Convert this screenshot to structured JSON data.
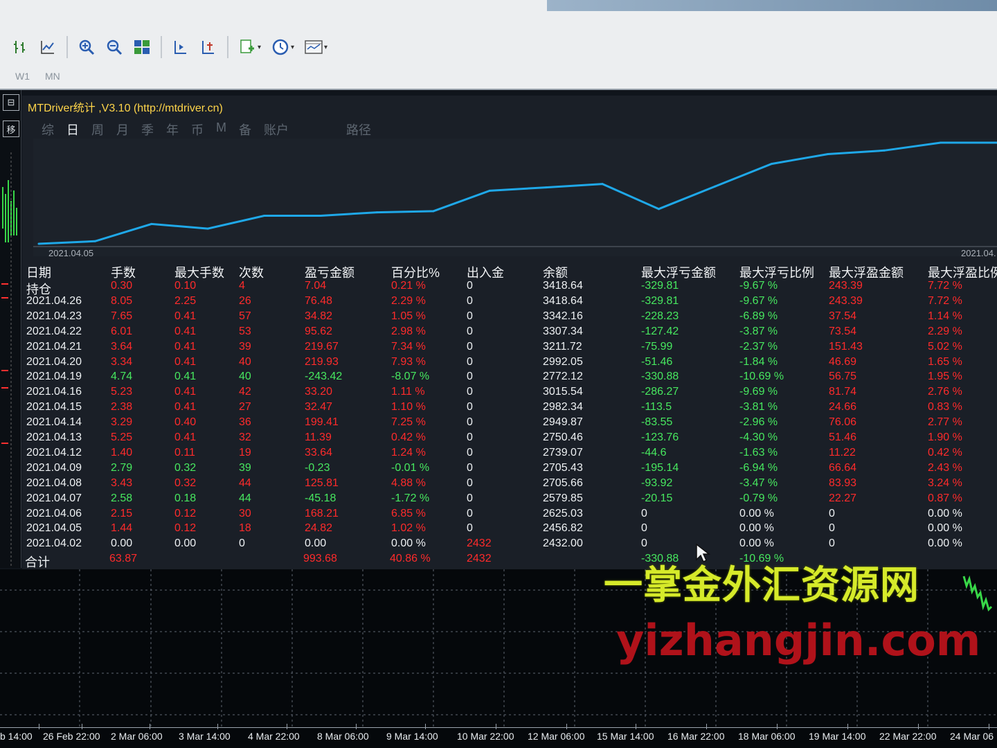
{
  "toolbar": {
    "timeframes": [
      "W1",
      "MN"
    ],
    "icons": [
      "bar-chart-icon",
      "line-chart-icon",
      "zoom-in-icon",
      "zoom-out-icon",
      "tile-windows-icon",
      "scroll-chart-icon",
      "chart-shift-icon",
      "add-indicator-icon",
      "clock-icon",
      "template-icon"
    ]
  },
  "panel": {
    "title": "MTDriver统计 ,V3.10 (http://mtdriver.cn)",
    "tabs": [
      "综",
      "日",
      "周",
      "月",
      "季",
      "年",
      "币",
      "M",
      "备",
      "账户"
    ],
    "active_tab": "日",
    "path_label": "路径"
  },
  "chart_data": {
    "type": "line",
    "x": [
      "2021.04.02",
      "2021.04.05",
      "2021.04.06",
      "2021.04.07",
      "2021.04.08",
      "2021.04.09",
      "2021.04.12",
      "2021.04.13",
      "2021.04.14",
      "2021.04.15",
      "2021.04.16",
      "2021.04.19",
      "2021.04.20",
      "2021.04.21",
      "2021.04.22",
      "2021.04.23",
      "2021.04.26",
      "持仓"
    ],
    "values": [
      2432.0,
      2456.82,
      2625.03,
      2579.85,
      2705.66,
      2705.43,
      2739.07,
      2750.46,
      2949.87,
      2982.34,
      3015.54,
      2772.12,
      2992.05,
      3211.72,
      3307.34,
      3342.16,
      3418.64,
      3418.64
    ],
    "x_start_label": "2021.04.05",
    "x_end_label": "2021.04.",
    "color": "#1fa8e8"
  },
  "table": {
    "headers": [
      "日期",
      "手数",
      "最大手数",
      "次数",
      "盈亏金额",
      "百分比%",
      "出入金",
      "余额",
      "最大浮亏金额",
      "最大浮亏比例",
      "最大浮盈金额",
      "最大浮盈比例"
    ],
    "rows": [
      [
        "持仓",
        "0.30",
        "0.10",
        "4",
        "7.04",
        "0.21 %",
        "0",
        "3418.64",
        "-329.81",
        "-9.67 %",
        "243.39",
        "7.72 %"
      ],
      [
        "2021.04.26",
        "8.05",
        "2.25",
        "26",
        "76.48",
        "2.29 %",
        "0",
        "3418.64",
        "-329.81",
        "-9.67 %",
        "243.39",
        "7.72 %"
      ],
      [
        "2021.04.23",
        "7.65",
        "0.41",
        "57",
        "34.82",
        "1.05 %",
        "0",
        "3342.16",
        "-228.23",
        "-6.89 %",
        "37.54",
        "1.14 %"
      ],
      [
        "2021.04.22",
        "6.01",
        "0.41",
        "53",
        "95.62",
        "2.98 %",
        "0",
        "3307.34",
        "-127.42",
        "-3.87 %",
        "73.54",
        "2.29 %"
      ],
      [
        "2021.04.21",
        "3.64",
        "0.41",
        "39",
        "219.67",
        "7.34 %",
        "0",
        "3211.72",
        "-75.99",
        "-2.37 %",
        "151.43",
        "5.02 %"
      ],
      [
        "2021.04.20",
        "3.34",
        "0.41",
        "40",
        "219.93",
        "7.93 %",
        "0",
        "2992.05",
        "-51.46",
        "-1.84 %",
        "46.69",
        "1.65 %"
      ],
      [
        "2021.04.19",
        "4.74",
        "0.41",
        "40",
        "-243.42",
        "-8.07 %",
        "0",
        "2772.12",
        "-330.88",
        "-10.69 %",
        "56.75",
        "1.95 %"
      ],
      [
        "2021.04.16",
        "5.23",
        "0.41",
        "42",
        "33.20",
        "1.11 %",
        "0",
        "3015.54",
        "-286.27",
        "-9.69 %",
        "81.74",
        "2.76 %"
      ],
      [
        "2021.04.15",
        "2.38",
        "0.41",
        "27",
        "32.47",
        "1.10 %",
        "0",
        "2982.34",
        "-113.5",
        "-3.81 %",
        "24.66",
        "0.83 %"
      ],
      [
        "2021.04.14",
        "3.29",
        "0.40",
        "36",
        "199.41",
        "7.25 %",
        "0",
        "2949.87",
        "-83.55",
        "-2.96 %",
        "76.06",
        "2.77 %"
      ],
      [
        "2021.04.13",
        "5.25",
        "0.41",
        "32",
        "11.39",
        "0.42 %",
        "0",
        "2750.46",
        "-123.76",
        "-4.30 %",
        "51.46",
        "1.90 %"
      ],
      [
        "2021.04.12",
        "1.40",
        "0.11",
        "19",
        "33.64",
        "1.24 %",
        "0",
        "2739.07",
        "-44.6",
        "-1.63 %",
        "11.22",
        "0.42 %"
      ],
      [
        "2021.04.09",
        "2.79",
        "0.32",
        "39",
        "-0.23",
        "-0.01 %",
        "0",
        "2705.43",
        "-195.14",
        "-6.94 %",
        "66.64",
        "2.43 %"
      ],
      [
        "2021.04.08",
        "3.43",
        "0.32",
        "44",
        "125.81",
        "4.88 %",
        "0",
        "2705.66",
        "-93.92",
        "-3.47 %",
        "83.93",
        "3.24 %"
      ],
      [
        "2021.04.07",
        "2.58",
        "0.18",
        "44",
        "-45.18",
        "-1.72 %",
        "0",
        "2579.85",
        "-20.15",
        "-0.79 %",
        "22.27",
        "0.87 %"
      ],
      [
        "2021.04.06",
        "2.15",
        "0.12",
        "30",
        "168.21",
        "6.85 %",
        "0",
        "2625.03",
        "0",
        "0.00 %",
        "0",
        "0.00 %"
      ],
      [
        "2021.04.05",
        "1.44",
        "0.12",
        "18",
        "24.82",
        "1.02 %",
        "0",
        "2456.82",
        "0",
        "0.00 %",
        "0",
        "0.00 %"
      ],
      [
        "2021.04.02",
        "0.00",
        "0.00",
        "0",
        "0.00",
        "0.00 %",
        "2432",
        "2432.00",
        "0",
        "0.00 %",
        "0",
        "0.00 %"
      ]
    ],
    "row_colors": [
      [
        "w",
        "r",
        "r",
        "r",
        "r",
        "r",
        "w",
        "w",
        "g",
        "g",
        "r",
        "r"
      ],
      [
        "w",
        "r",
        "r",
        "r",
        "r",
        "r",
        "w",
        "w",
        "g",
        "g",
        "r",
        "r"
      ],
      [
        "w",
        "r",
        "r",
        "r",
        "r",
        "r",
        "w",
        "w",
        "g",
        "g",
        "r",
        "r"
      ],
      [
        "w",
        "r",
        "r",
        "r",
        "r",
        "r",
        "w",
        "w",
        "g",
        "g",
        "r",
        "r"
      ],
      [
        "w",
        "r",
        "r",
        "r",
        "r",
        "r",
        "w",
        "w",
        "g",
        "g",
        "r",
        "r"
      ],
      [
        "w",
        "r",
        "r",
        "r",
        "r",
        "r",
        "w",
        "w",
        "g",
        "g",
        "r",
        "r"
      ],
      [
        "w",
        "g",
        "g",
        "g",
        "g",
        "g",
        "w",
        "w",
        "g",
        "g",
        "r",
        "r"
      ],
      [
        "w",
        "r",
        "r",
        "r",
        "r",
        "r",
        "w",
        "w",
        "g",
        "g",
        "r",
        "r"
      ],
      [
        "w",
        "r",
        "r",
        "r",
        "r",
        "r",
        "w",
        "w",
        "g",
        "g",
        "r",
        "r"
      ],
      [
        "w",
        "r",
        "r",
        "r",
        "r",
        "r",
        "w",
        "w",
        "g",
        "g",
        "r",
        "r"
      ],
      [
        "w",
        "r",
        "r",
        "r",
        "r",
        "r",
        "w",
        "w",
        "g",
        "g",
        "r",
        "r"
      ],
      [
        "w",
        "r",
        "r",
        "r",
        "r",
        "r",
        "w",
        "w",
        "g",
        "g",
        "r",
        "r"
      ],
      [
        "w",
        "g",
        "g",
        "g",
        "g",
        "g",
        "w",
        "w",
        "g",
        "g",
        "r",
        "r"
      ],
      [
        "w",
        "r",
        "r",
        "r",
        "r",
        "r",
        "w",
        "w",
        "g",
        "g",
        "r",
        "r"
      ],
      [
        "w",
        "g",
        "g",
        "g",
        "g",
        "g",
        "w",
        "w",
        "g",
        "g",
        "r",
        "r"
      ],
      [
        "w",
        "r",
        "r",
        "r",
        "r",
        "r",
        "w",
        "w",
        "w",
        "w",
        "w",
        "w"
      ],
      [
        "w",
        "r",
        "r",
        "r",
        "r",
        "r",
        "w",
        "w",
        "w",
        "w",
        "w",
        "w"
      ],
      [
        "w",
        "w",
        "w",
        "w",
        "w",
        "w",
        "r",
        "w",
        "w",
        "w",
        "w",
        "w"
      ]
    ],
    "total": {
      "label": "合计",
      "lots": "63.87",
      "profit": "993.68",
      "percent": "40.86 %",
      "deposit": "2432",
      "max_float_loss": "-330.88",
      "max_float_loss_pct": "-10.69 %"
    }
  },
  "watermark": {
    "line1": "一掌金外汇资源网",
    "line2": "yizhangjin.com"
  },
  "time_axis": [
    "b 14:00",
    "26 Feb 22:00",
    "2 Mar 06:00",
    "3 Mar 14:00",
    "4 Mar 22:00",
    "8 Mar 06:00",
    "9 Mar 14:00",
    "10 Mar 22:00",
    "12 Mar 06:00",
    "15 Mar 14:00",
    "16 Mar 22:00",
    "18 Mar 06:00",
    "19 Mar 14:00",
    "22 Mar 22:00",
    "24 Mar 06"
  ]
}
